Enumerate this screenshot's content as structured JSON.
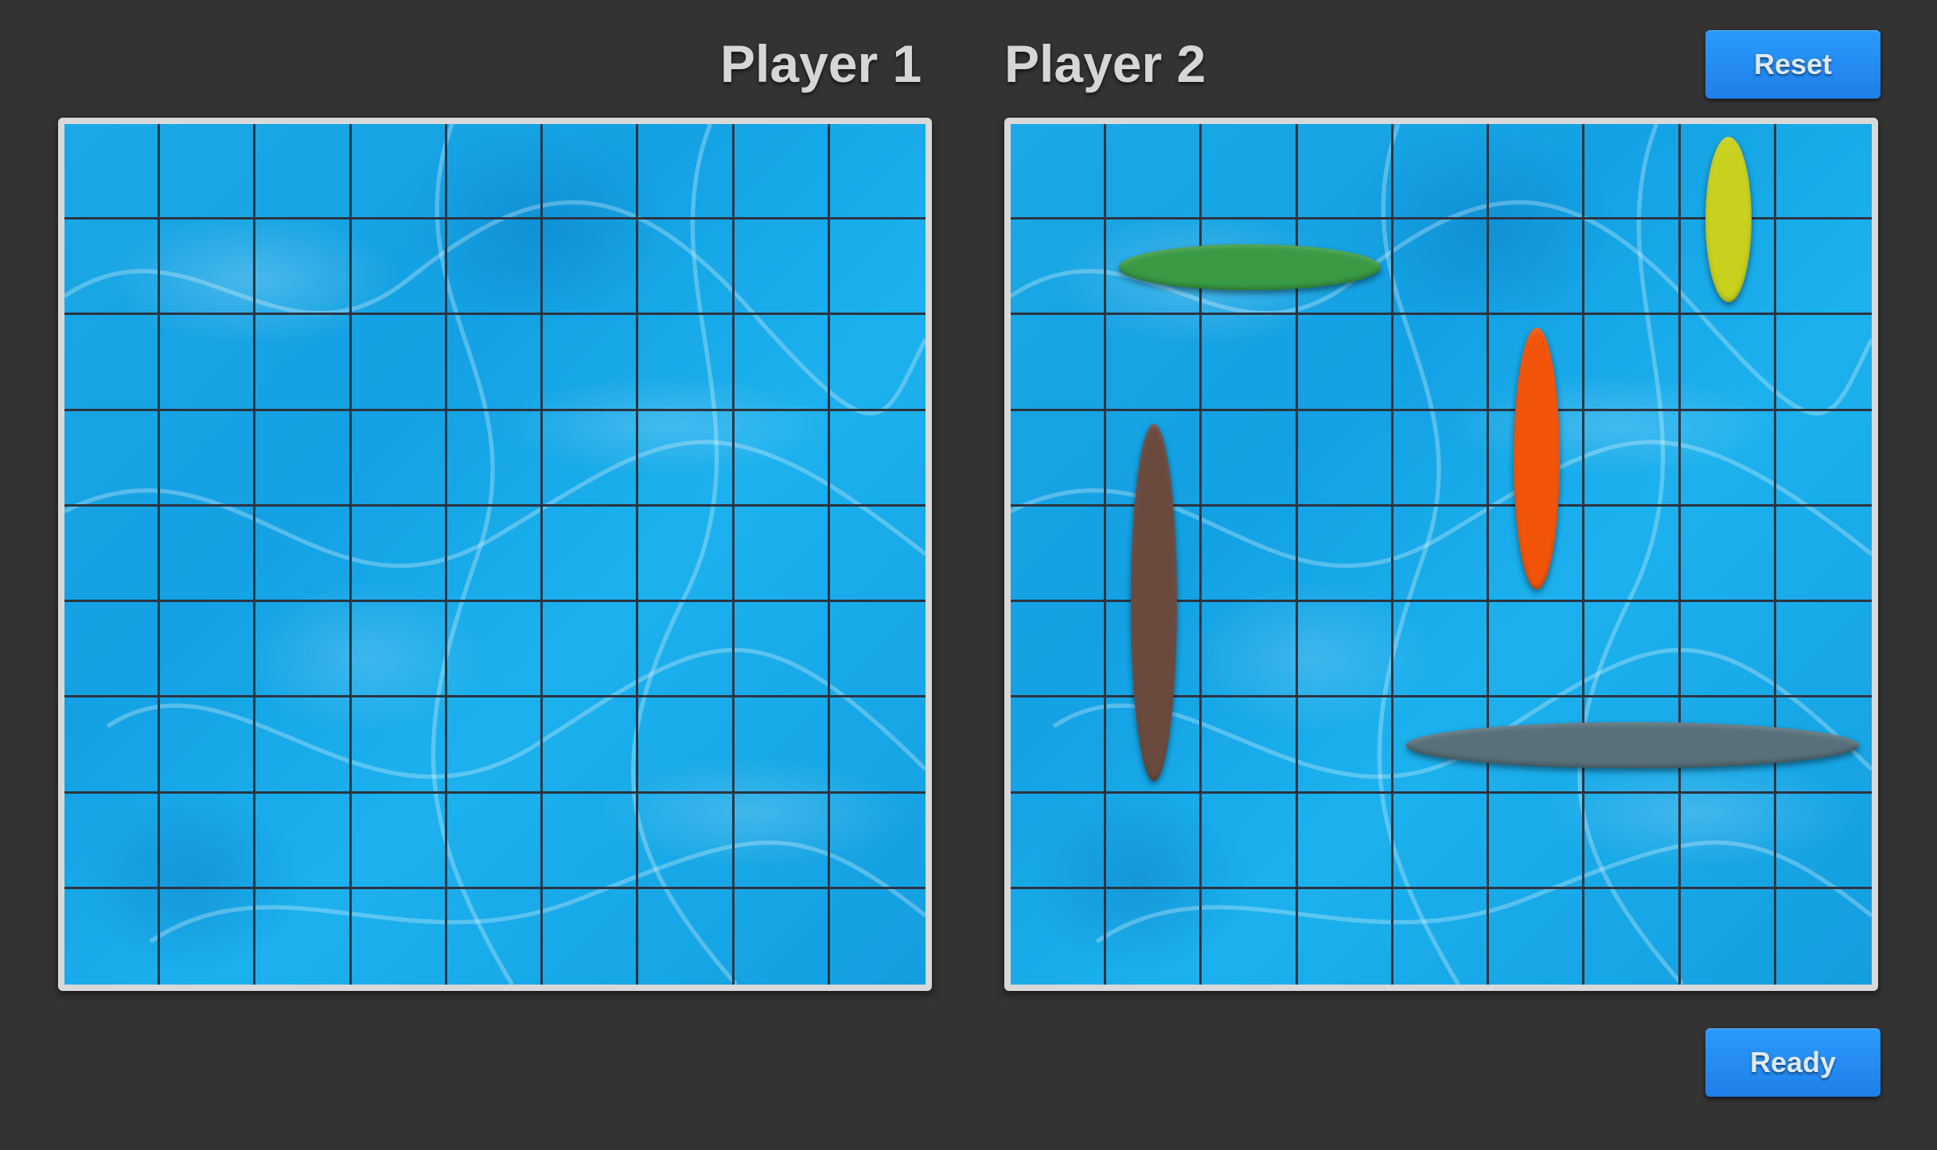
{
  "players": {
    "p1": {
      "label": "Player 1"
    },
    "p2": {
      "label": "Player 2"
    }
  },
  "buttons": {
    "reset_label": "Reset",
    "ready_label": "Ready"
  },
  "board": {
    "rows": 9,
    "cols": 9
  },
  "ships": [
    {
      "name": "yellow-ship",
      "color": "#c8d21e",
      "orientation": "vertical",
      "row": 0,
      "col": 7,
      "length": 2
    },
    {
      "name": "green-ship",
      "color": "#3a9b44",
      "orientation": "horizontal",
      "row": 1,
      "col": 1,
      "length": 3
    },
    {
      "name": "orange-ship",
      "color": "#f2540a",
      "orientation": "vertical",
      "row": 2,
      "col": 5,
      "length": 3
    },
    {
      "name": "brown-ship",
      "color": "#6b4a3e",
      "orientation": "vertical",
      "row": 3,
      "col": 1,
      "length": 4
    },
    {
      "name": "gray-ship",
      "color": "#58707a",
      "orientation": "horizontal",
      "row": 6,
      "col": 4,
      "length": 5
    }
  ],
  "colors": {
    "background": "#333333",
    "button": "#1e88f0",
    "frame": "#d9d9d9",
    "grid_line": "#2b3440",
    "water": "#1aa8e6"
  }
}
